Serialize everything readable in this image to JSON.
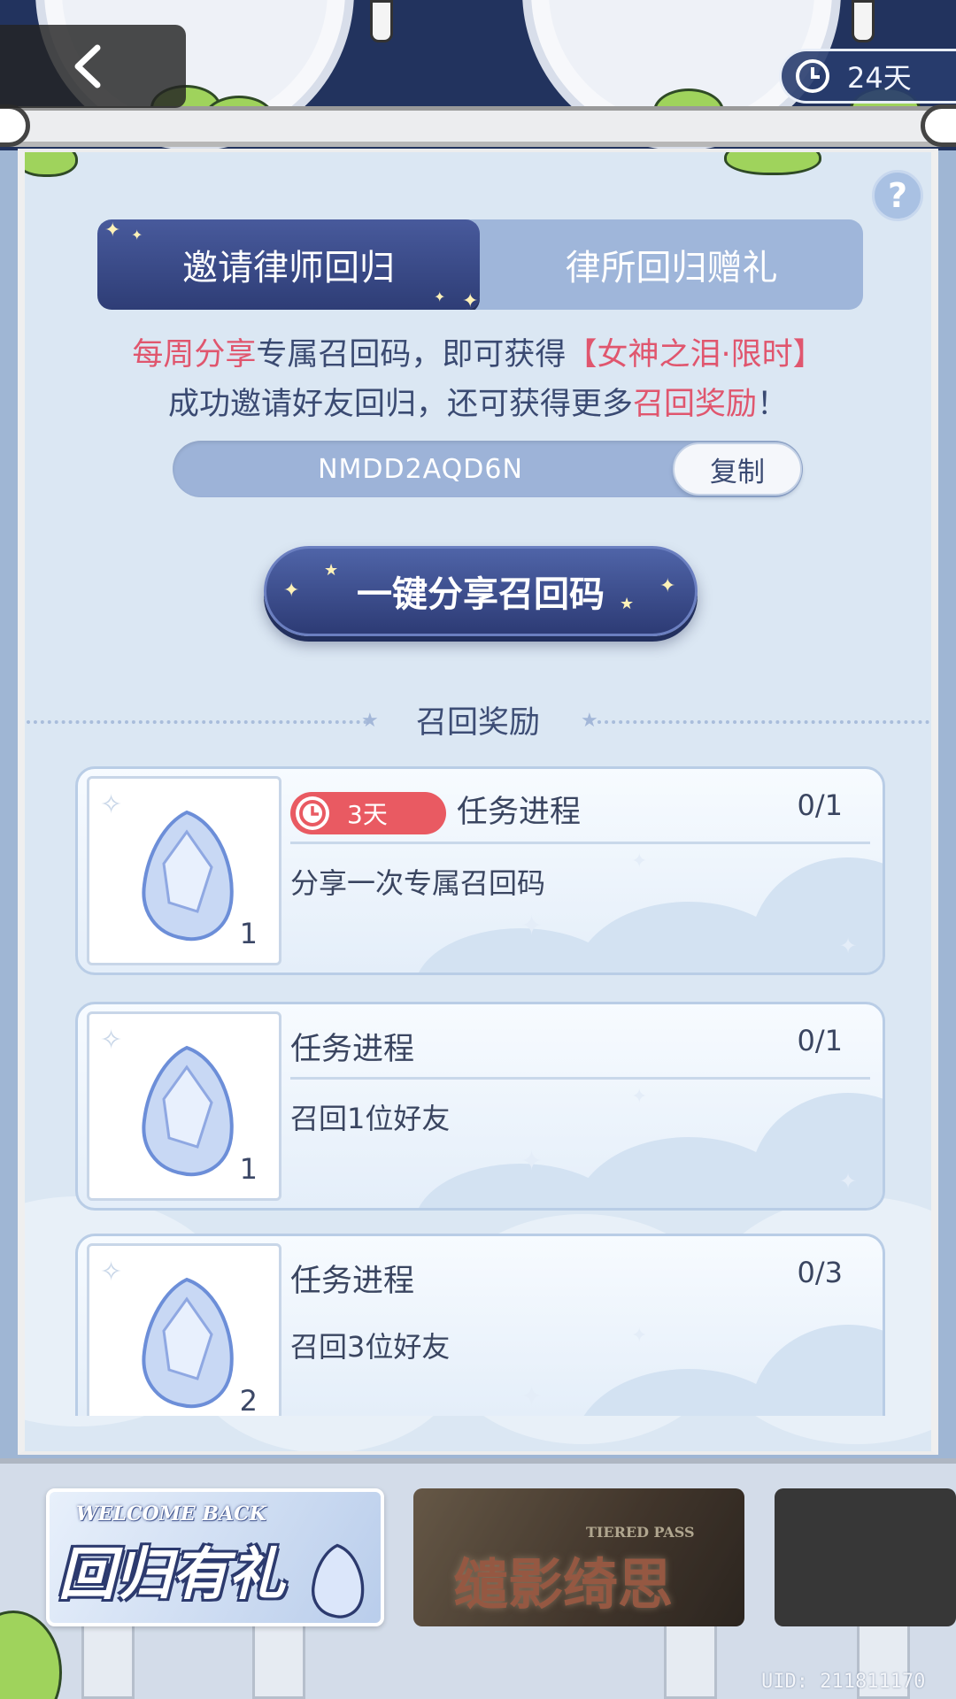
{
  "header": {
    "back_icon": "chevron-left-icon",
    "timer_icon": "clock-icon",
    "timer_text": "24天"
  },
  "help": {
    "label": "?"
  },
  "tabs": [
    {
      "label": "邀请律师回归",
      "active": true
    },
    {
      "label": "律所回归赠礼",
      "active": false
    }
  ],
  "notice": {
    "line1_hl1": "每周分享",
    "line1_mid": "专属召回码，即可获得",
    "line1_hl2": "【女神之泪·限时】",
    "line2_pre": "成功邀请好友回归，还可获得更多",
    "line2_hl": "召回奖励",
    "line2_post": "！"
  },
  "code": {
    "value": "NMDD2AQD6N",
    "copy_label": "复制"
  },
  "share_button": {
    "label": "一键分享召回码"
  },
  "rewards_section": {
    "title": "召回奖励"
  },
  "tasks": [
    {
      "deadline": "3天",
      "title": "任务进程",
      "progress": "0/1",
      "desc": "分享一次专属召回码",
      "reward_qty": "1",
      "reward_icon": "gem-icon"
    },
    {
      "title": "任务进程",
      "progress": "0/1",
      "desc": "召回1位好友",
      "reward_qty": "1",
      "reward_icon": "gem-icon"
    },
    {
      "title": "任务进程",
      "progress": "0/3",
      "desc": "召回3位好友",
      "reward_qty": "2",
      "reward_icon": "gem-icon"
    }
  ],
  "events": [
    {
      "en": "WELCOME BACK",
      "title": "回归有礼"
    },
    {
      "en": "TIERED PASS",
      "title": "缱影绮思"
    },
    {
      "title": ""
    }
  ],
  "footer": {
    "uid": "UID: 211811170"
  },
  "colors": {
    "accent_navy": "#2e3d76",
    "highlight_pink": "#e0566e",
    "deadline_red": "#e95a62",
    "panel_bg": "#dbe7f3"
  }
}
